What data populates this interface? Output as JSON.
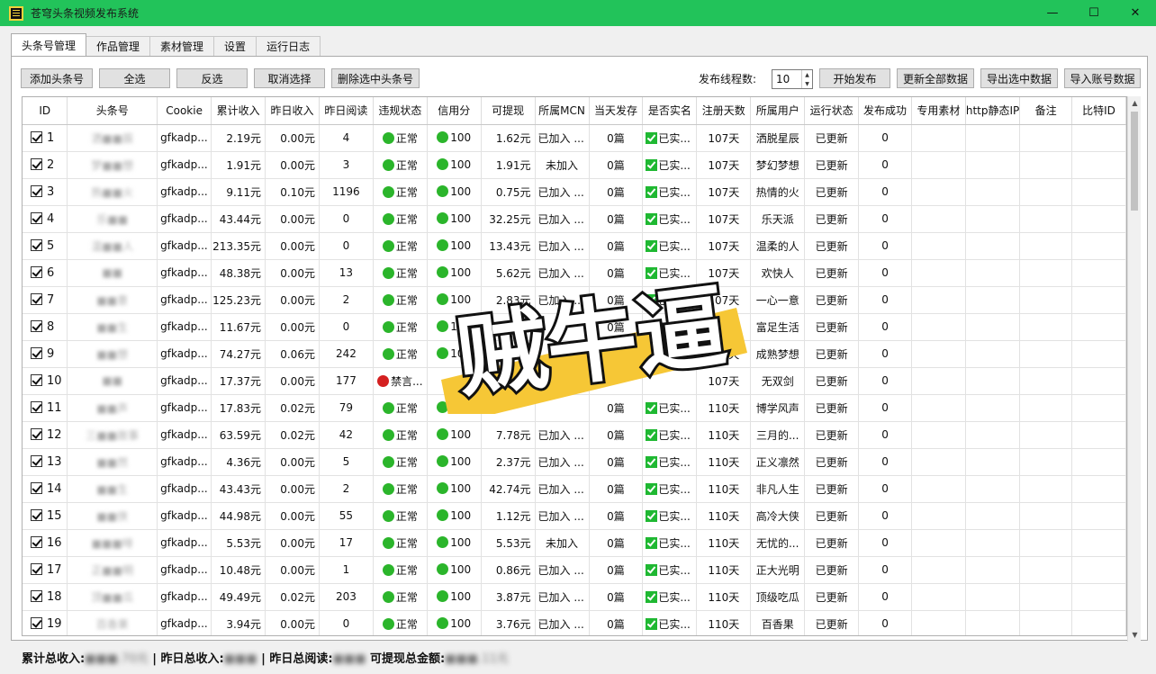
{
  "window": {
    "title": "苍穹头条视频发布系统",
    "minimize": "—",
    "maximize": "☐",
    "close": "✕"
  },
  "tabs": [
    "头条号管理",
    "作品管理",
    "素材管理",
    "设置",
    "运行日志"
  ],
  "toolbar": {
    "add": "添加头条号",
    "select_all": "全选",
    "invert": "反选",
    "cancel": "取消选择",
    "delete": "删除选中头条号",
    "thread_label": "发布线程数:",
    "thread_value": "10",
    "start": "开始发布",
    "update_all": "更新全部数据",
    "export": "导出选中数据",
    "import": "导入账号数据"
  },
  "columns": [
    "ID",
    "头条号",
    "Cookie",
    "累计收入",
    "昨日收入",
    "昨日阅读",
    "违规状态",
    "信用分",
    "可提现",
    "所属MCN",
    "当天发存",
    "是否实名",
    "注册天数",
    "所属用户",
    "运行状态",
    "发布成功",
    "专用素材",
    "http静态IP",
    "备注",
    "比特ID"
  ],
  "rows": [
    {
      "id": "1",
      "name": "洒■■辰",
      "cookie": "gfkadp...",
      "total": "2.19元",
      "yday": "0.00元",
      "reads": "4",
      "violation": "正常",
      "vstatus": "ok",
      "credit": "100",
      "withdraw": "1.62元",
      "mcn": "已加入 ...",
      "daily": "0篇",
      "realname": "已实...",
      "days": "107天",
      "user": "洒脱星辰",
      "run": "已更新",
      "success": "0"
    },
    {
      "id": "2",
      "name": "梦■■想",
      "cookie": "gfkadp...",
      "total": "1.91元",
      "yday": "0.00元",
      "reads": "3",
      "violation": "正常",
      "vstatus": "ok",
      "credit": "100",
      "withdraw": "1.91元",
      "mcn": "未加入",
      "daily": "0篇",
      "realname": "已实...",
      "days": "107天",
      "user": "梦幻梦想",
      "run": "已更新",
      "success": "0"
    },
    {
      "id": "3",
      "name": "热■■火",
      "cookie": "gfkadp...",
      "total": "9.11元",
      "yday": "0.10元",
      "reads": "1196",
      "violation": "正常",
      "vstatus": "ok",
      "credit": "100",
      "withdraw": "0.75元",
      "mcn": "已加入 ...",
      "daily": "0篇",
      "realname": "已实...",
      "days": "107天",
      "user": "热情的火",
      "run": "已更新",
      "success": "0"
    },
    {
      "id": "4",
      "name": "乐■■",
      "cookie": "gfkadp...",
      "total": "43.44元",
      "yday": "0.00元",
      "reads": "0",
      "violation": "正常",
      "vstatus": "ok",
      "credit": "100",
      "withdraw": "32.25元",
      "mcn": "已加入 ...",
      "daily": "0篇",
      "realname": "已实...",
      "days": "107天",
      "user": "乐天派",
      "run": "已更新",
      "success": "0"
    },
    {
      "id": "5",
      "name": "温■■人",
      "cookie": "gfkadp...",
      "total": "213.35元",
      "yday": "0.00元",
      "reads": "0",
      "violation": "正常",
      "vstatus": "ok",
      "credit": "100",
      "withdraw": "13.43元",
      "mcn": "已加入 ...",
      "daily": "0篇",
      "realname": "已实...",
      "days": "107天",
      "user": "温柔的人",
      "run": "已更新",
      "success": "0"
    },
    {
      "id": "6",
      "name": "■■",
      "cookie": "gfkadp...",
      "total": "48.38元",
      "yday": "0.00元",
      "reads": "13",
      "violation": "正常",
      "vstatus": "ok",
      "credit": "100",
      "withdraw": "5.62元",
      "mcn": "已加入 ...",
      "daily": "0篇",
      "realname": "已实...",
      "days": "107天",
      "user": "欢快人",
      "run": "已更新",
      "success": "0"
    },
    {
      "id": "7",
      "name": "■■意",
      "cookie": "gfkadp...",
      "total": "125.23元",
      "yday": "0.00元",
      "reads": "2",
      "violation": "正常",
      "vstatus": "ok",
      "credit": "100",
      "withdraw": "2.83元",
      "mcn": "已加入 ...",
      "daily": "0篇",
      "realname": "已实...",
      "days": "107天",
      "user": "一心一意",
      "run": "已更新",
      "success": "0"
    },
    {
      "id": "8",
      "name": "■■生",
      "cookie": "gfkadp...",
      "total": "11.67元",
      "yday": "0.00元",
      "reads": "0",
      "violation": "正常",
      "vstatus": "ok",
      "credit": "100",
      "withdraw": "",
      "mcn": "",
      "daily": "0篇",
      "realname": "已实...",
      "days": "107天",
      "user": "富足生活",
      "run": "已更新",
      "success": "0"
    },
    {
      "id": "9",
      "name": "■■想",
      "cookie": "gfkadp...",
      "total": "74.27元",
      "yday": "0.06元",
      "reads": "242",
      "violation": "正常",
      "vstatus": "ok",
      "credit": "100",
      "withdraw": "",
      "mcn": "",
      "daily": "0篇",
      "realname": "已实...",
      "days": "107天",
      "user": "成熟梦想",
      "run": "已更新",
      "success": "0"
    },
    {
      "id": "10",
      "name": "■■",
      "cookie": "gfkadp...",
      "total": "17.37元",
      "yday": "0.00元",
      "reads": "177",
      "violation": "禁言...",
      "vstatus": "bad",
      "credit": "",
      "withdraw": "",
      "mcn": "",
      "daily": "",
      "realname": "",
      "days": "107天",
      "user": "无双剑",
      "run": "已更新",
      "success": "0"
    },
    {
      "id": "11",
      "name": "■■声",
      "cookie": "gfkadp...",
      "total": "17.83元",
      "yday": "0.02元",
      "reads": "79",
      "violation": "正常",
      "vstatus": "ok",
      "credit": "100",
      "withdraw": "",
      "mcn": "",
      "daily": "0篇",
      "realname": "已实...",
      "days": "110天",
      "user": "博学风声",
      "run": "已更新",
      "success": "0"
    },
    {
      "id": "12",
      "name": "三■■故事",
      "cookie": "gfkadp...",
      "total": "63.59元",
      "yday": "0.02元",
      "reads": "42",
      "violation": "正常",
      "vstatus": "ok",
      "credit": "100",
      "withdraw": "7.78元",
      "mcn": "已加入 ...",
      "daily": "0篇",
      "realname": "已实...",
      "days": "110天",
      "user": "三月的...",
      "run": "已更新",
      "success": "0"
    },
    {
      "id": "13",
      "name": "■■然",
      "cookie": "gfkadp...",
      "total": "4.36元",
      "yday": "0.00元",
      "reads": "5",
      "violation": "正常",
      "vstatus": "ok",
      "credit": "100",
      "withdraw": "2.37元",
      "mcn": "已加入 ...",
      "daily": "0篇",
      "realname": "已实...",
      "days": "110天",
      "user": "正义凛然",
      "run": "已更新",
      "success": "0"
    },
    {
      "id": "14",
      "name": "■■生",
      "cookie": "gfkadp...",
      "total": "43.43元",
      "yday": "0.00元",
      "reads": "2",
      "violation": "正常",
      "vstatus": "ok",
      "credit": "100",
      "withdraw": "42.74元",
      "mcn": "已加入 ...",
      "daily": "0篇",
      "realname": "已实...",
      "days": "110天",
      "user": "非凡人生",
      "run": "已更新",
      "success": "0"
    },
    {
      "id": "15",
      "name": "■■侠",
      "cookie": "gfkadp...",
      "total": "44.98元",
      "yday": "0.00元",
      "reads": "55",
      "violation": "正常",
      "vstatus": "ok",
      "credit": "100",
      "withdraw": "1.12元",
      "mcn": "已加入 ...",
      "daily": "0篇",
      "realname": "已实...",
      "days": "110天",
      "user": "高冷大侠",
      "run": "已更新",
      "success": "0"
    },
    {
      "id": "16",
      "name": "■■■啡",
      "cookie": "gfkadp...",
      "total": "5.53元",
      "yday": "0.00元",
      "reads": "17",
      "violation": "正常",
      "vstatus": "ok",
      "credit": "100",
      "withdraw": "5.53元",
      "mcn": "未加入",
      "daily": "0篇",
      "realname": "已实...",
      "days": "110天",
      "user": "无忧的...",
      "run": "已更新",
      "success": "0"
    },
    {
      "id": "17",
      "name": "正■■明",
      "cookie": "gfkadp...",
      "total": "10.48元",
      "yday": "0.00元",
      "reads": "1",
      "violation": "正常",
      "vstatus": "ok",
      "credit": "100",
      "withdraw": "0.86元",
      "mcn": "已加入 ...",
      "daily": "0篇",
      "realname": "已实...",
      "days": "110天",
      "user": "正大光明",
      "run": "已更新",
      "success": "0"
    },
    {
      "id": "18",
      "name": "顶■■瓜",
      "cookie": "gfkadp...",
      "total": "49.49元",
      "yday": "0.02元",
      "reads": "203",
      "violation": "正常",
      "vstatus": "ok",
      "credit": "100",
      "withdraw": "3.87元",
      "mcn": "已加入 ...",
      "daily": "0篇",
      "realname": "已实...",
      "days": "110天",
      "user": "顶级吃瓜",
      "run": "已更新",
      "success": "0"
    },
    {
      "id": "19",
      "name": "百香果",
      "cookie": "gfkadp...",
      "total": "3.94元",
      "yday": "0.00元",
      "reads": "0",
      "violation": "正常",
      "vstatus": "ok",
      "credit": "100",
      "withdraw": "3.76元",
      "mcn": "已加入 ...",
      "daily": "0篇",
      "realname": "已实...",
      "days": "110天",
      "user": "百香果",
      "run": "已更新",
      "success": "0"
    }
  ],
  "status_bar": {
    "total_label": "累计总收入:",
    "total_value": "■■■.70元",
    "sep1": " | ",
    "yday_label": "昨日总收入:",
    "yday_value": "■■■",
    "sep2": " | ",
    "reads_label": "昨日总阅读:",
    "reads_value": "■■■",
    "withdraw_label": "可提现总金额:",
    "withdraw_value": "■■■.11元"
  },
  "overlay": {
    "text": "贼牛逼",
    "colors": {
      "highlight": "#f6c736",
      "text": "#ffffff",
      "stroke": "#111111"
    }
  },
  "colors": {
    "titlebar": "#22c35a",
    "ok_dot": "#2bb52b",
    "bad_dot": "#d42020",
    "realname_check": "#1fb832"
  }
}
